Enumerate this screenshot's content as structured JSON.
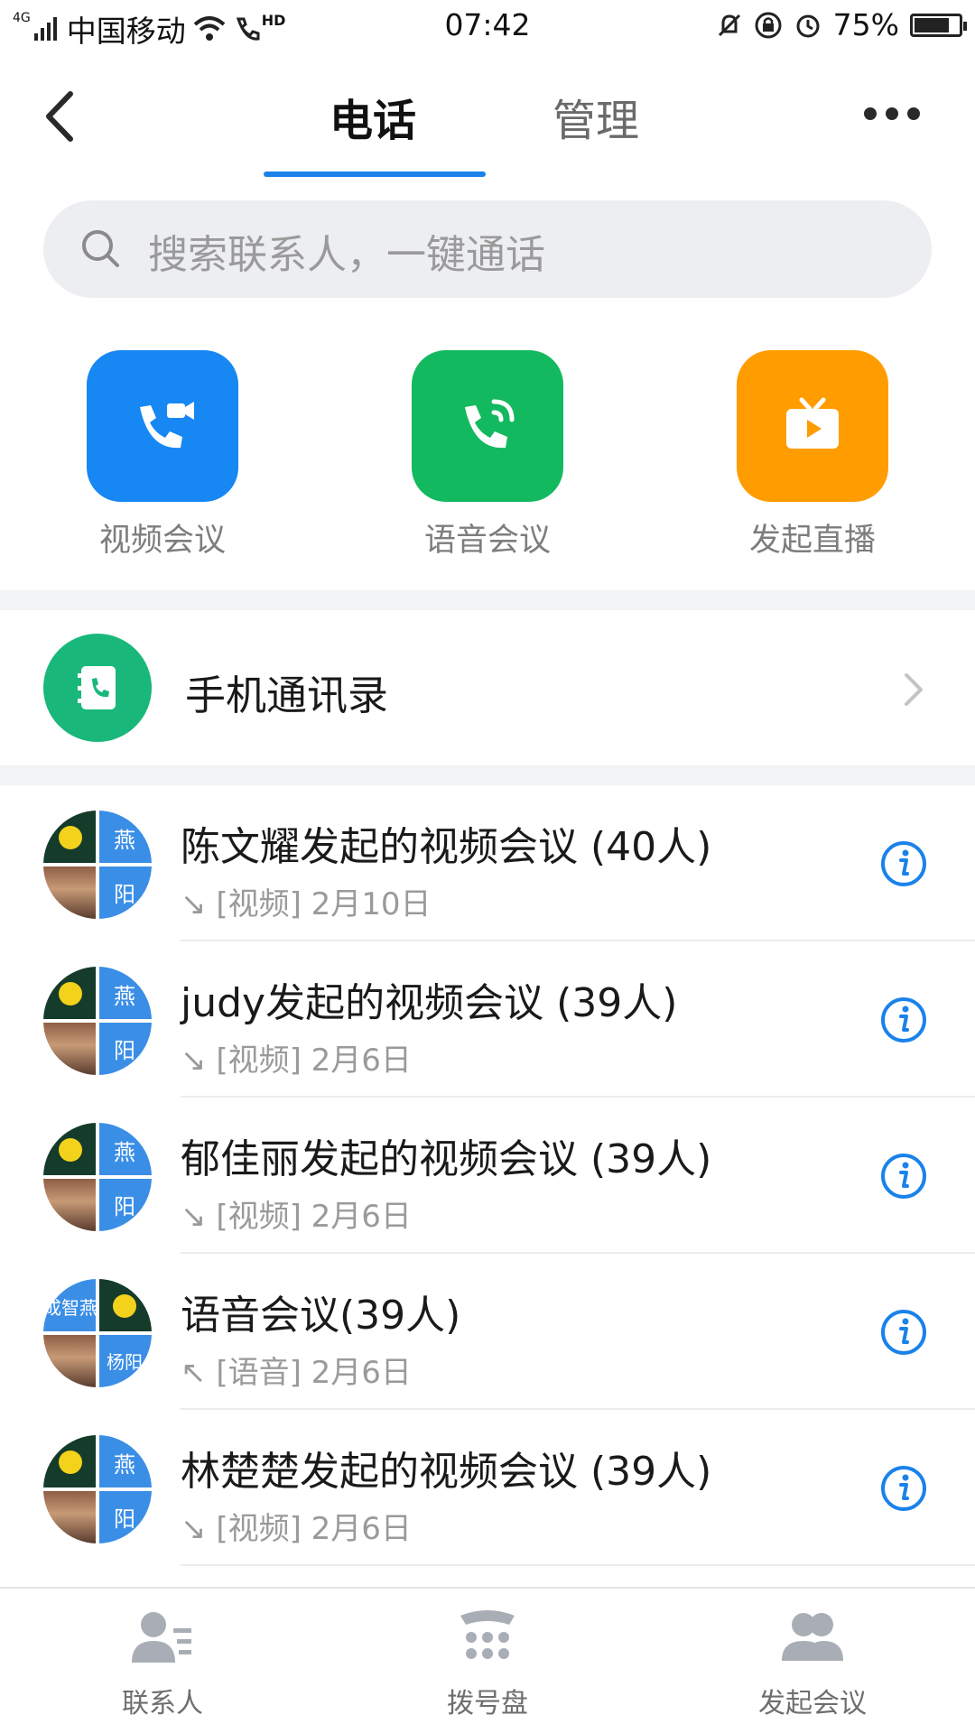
{
  "status_bar": {
    "network": "4G",
    "carrier": "中国移动",
    "hd_label": "HD",
    "time": "07:42",
    "battery_text": "75%",
    "battery_level": 0.75
  },
  "header": {
    "tabs": [
      {
        "label": "电话",
        "active": true
      },
      {
        "label": "管理",
        "active": false
      }
    ],
    "accent_color": "#1a82ea"
  },
  "search": {
    "placeholder": "搜索联系人，一键通话"
  },
  "quick_actions": [
    {
      "label": "视频会议",
      "icon": "video-call-icon",
      "color": "#1787f4"
    },
    {
      "label": "语音会议",
      "icon": "voice-call-icon",
      "color": "#12b95e"
    },
    {
      "label": "发起直播",
      "icon": "live-tv-icon",
      "color": "#ff9c00"
    }
  ],
  "contacts_entry": {
    "label": "手机通讯录",
    "icon": "phone-book-icon",
    "color": "#19b87a"
  },
  "calls": [
    {
      "title": "陈文耀发起的视频会议 (40人)",
      "direction": "↘",
      "type": "[视频]",
      "date": "2月10日",
      "avatar": [
        "",
        "燕",
        "",
        "阳"
      ]
    },
    {
      "title": "judy发起的视频会议 (39人)",
      "direction": "↘",
      "type": "[视频]",
      "date": "2月6日",
      "avatar": [
        "",
        "燕",
        "",
        "阳"
      ]
    },
    {
      "title": "郁佳丽发起的视频会议 (39人)",
      "direction": "↘",
      "type": "[视频]",
      "date": "2月6日",
      "avatar": [
        "",
        "燕",
        "",
        "阳"
      ]
    },
    {
      "title": "语音会议(39人)",
      "direction": "↖",
      "type": "[语音]",
      "date": "2月6日",
      "avatar": [
        "成智燕",
        "",
        "",
        "杨阳"
      ]
    },
    {
      "title": "林楚楚发起的视频会议 (39人)",
      "direction": "↘",
      "type": "[视频]",
      "date": "2月6日",
      "avatar": [
        "",
        "燕",
        "",
        "阳"
      ]
    }
  ],
  "bottom_nav": [
    {
      "label": "联系人",
      "icon": "contacts-icon"
    },
    {
      "label": "拨号盘",
      "icon": "dialpad-icon"
    },
    {
      "label": "发起会议",
      "icon": "group-meeting-icon"
    }
  ]
}
